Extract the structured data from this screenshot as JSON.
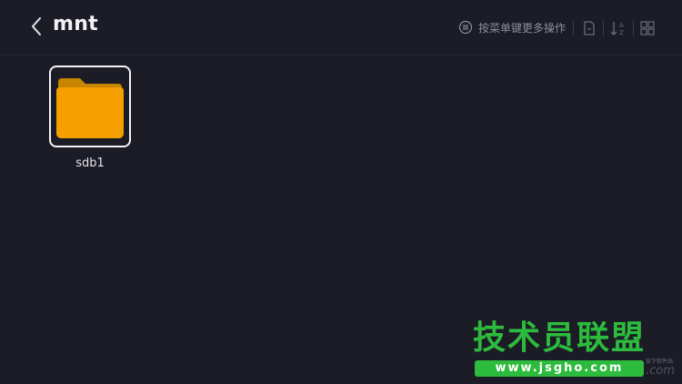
{
  "header": {
    "title": "mnt",
    "menu_hint": "按菜单键更多操作",
    "icons": {
      "back": "chevron-left-icon",
      "menu": "menu-circle-icon",
      "file": "file-icon",
      "sort": "sort-az-icon",
      "grid": "grid-view-icon"
    }
  },
  "files": [
    {
      "name": "sdb1",
      "type": "folder",
      "icon": "folder-icon"
    }
  ],
  "colors": {
    "background": "#1b1c25",
    "folder": "#f5a000",
    "watermark": "#2dbb3e"
  },
  "watermark": {
    "title": "技术员联盟",
    "url": "www.jsgho.com",
    "small": "安下软件站",
    "com": ".com"
  }
}
